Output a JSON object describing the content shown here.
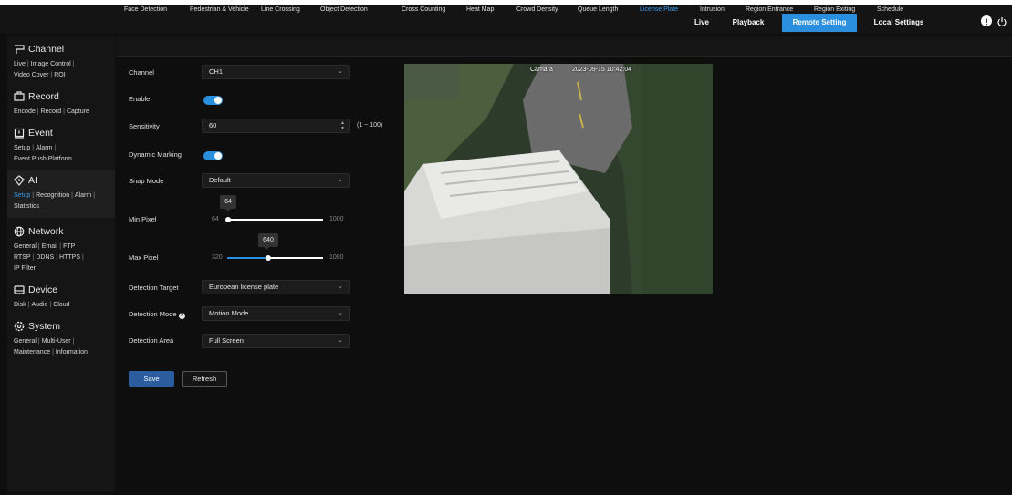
{
  "topnav": {
    "live": "Live",
    "playback": "Playback",
    "remote_setting": "Remote Setting",
    "local_settings": "Local Settings"
  },
  "sidebar": {
    "channel": {
      "title": "Channel",
      "links": [
        "Live",
        "Image Control",
        "Video Cover",
        "ROI"
      ]
    },
    "record": {
      "title": "Record",
      "links": [
        "Encode",
        "Record",
        "Capture"
      ]
    },
    "event": {
      "title": "Event",
      "links": [
        "Setup",
        "Alarm",
        "Event Push Platform"
      ]
    },
    "ai": {
      "title": "AI",
      "links": [
        "Setup",
        "Recognition",
        "Alarm",
        "Statistics"
      ]
    },
    "network": {
      "title": "Network",
      "links": [
        "General",
        "Email",
        "FTP",
        "RTSP",
        "DDNS",
        "HTTPS",
        "IP Filter"
      ]
    },
    "device": {
      "title": "Device",
      "links": [
        "Disk",
        "Audio",
        "Cloud"
      ]
    },
    "system": {
      "title": "System",
      "links": [
        "General",
        "Multi-User",
        "Maintenance",
        "Information"
      ]
    }
  },
  "tabs": [
    "Face Detection",
    "Pedestrian & Vehicle",
    "Line Crossing",
    "Object Detection",
    "Cross Counting",
    "Heat Map",
    "Crowd Density",
    "Queue Length",
    "License Plate",
    "Intrusion",
    "Region Entrance",
    "Region Exiting",
    "Schedule"
  ],
  "active_tab": "License Plate",
  "form": {
    "channel_label": "Channel",
    "channel_value": "CH1",
    "enable_label": "Enable",
    "enable_on": true,
    "sensitivity_label": "Sensitivity",
    "sensitivity_value": "60",
    "sensitivity_range": "(1 ~ 100)",
    "dynamic_marking_label": "Dynamic Marking",
    "dynamic_marking_on": true,
    "snap_mode_label": "Snap Mode",
    "snap_mode_value": "Default",
    "min_pixel_label": "Min Pixel",
    "min_pixel": {
      "value": "64",
      "min": "64",
      "max": "1000"
    },
    "max_pixel_label": "Max Pixel",
    "max_pixel": {
      "value": "640",
      "min": "320",
      "max": "1080"
    },
    "detection_target_label": "Detection Target",
    "detection_target_value": "European license plate",
    "detection_mode_label": "Detection Mode",
    "detection_mode_value": "Motion Mode",
    "detection_area_label": "Detection Area",
    "detection_area_value": "Full Screen"
  },
  "buttons": {
    "save": "Save",
    "refresh": "Refresh"
  },
  "camera": {
    "name": "Camara",
    "timestamp": "2023-09-15 10:42:04"
  },
  "colors": {
    "accent": "#2b8fe0",
    "background": "#0e0e0e",
    "panel": "#151515"
  },
  "icons": [
    "channel-icon",
    "record-icon",
    "event-icon",
    "ai-icon",
    "network-icon",
    "device-icon",
    "system-icon",
    "alert-icon",
    "power-icon",
    "chevron-down-icon",
    "help-icon"
  ]
}
